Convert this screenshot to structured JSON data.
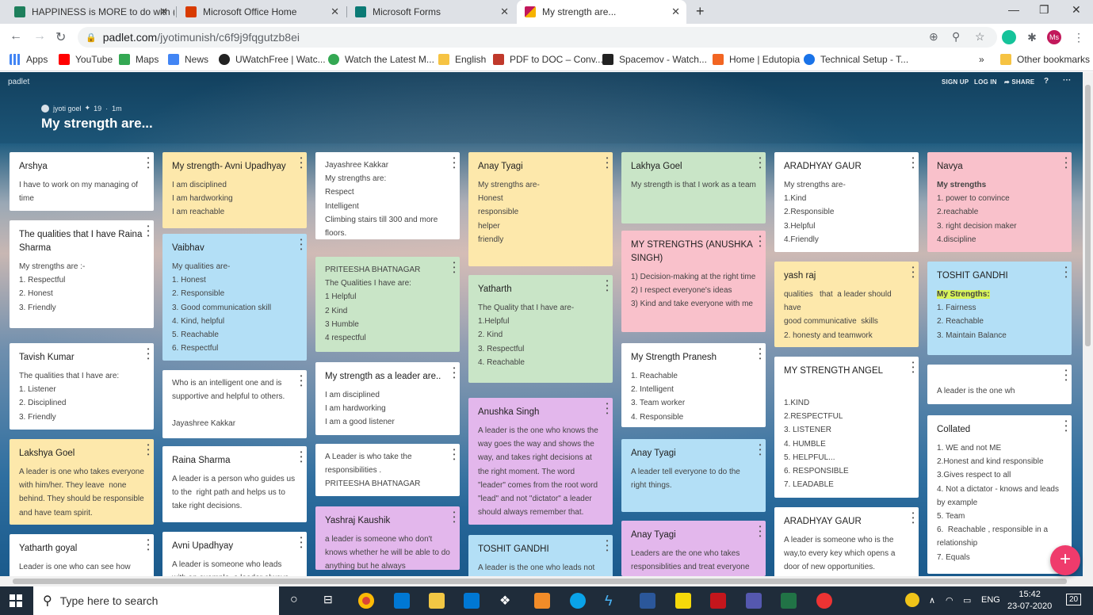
{
  "browser": {
    "tabs": [
      {
        "title": "HAPPINESS is MORE to do with (",
        "color": "#1e7f5c"
      },
      {
        "title": "Microsoft Office Home",
        "color": "#d83b01"
      },
      {
        "title": "Microsoft Forms",
        "color": "#0b7a75"
      },
      {
        "title": "My strength are...",
        "color": "#c2185b"
      }
    ],
    "url_host": "padlet.com",
    "url_path": "/jyotimunish/c6f9j9fqgutzb8ei",
    "profile_initials": "Ms",
    "bookmarks": [
      {
        "label": "Apps",
        "color": "#4285f4"
      },
      {
        "label": "YouTube",
        "color": "#ff0000"
      },
      {
        "label": "Maps",
        "color": "#34a853"
      },
      {
        "label": "News",
        "color": "#4285f4"
      },
      {
        "label": "UWatchFree | Watc...",
        "color": "#222222"
      },
      {
        "label": "Watch the Latest M...",
        "color": "#34a853"
      },
      {
        "label": "English",
        "color": "#f6c343"
      },
      {
        "label": "PDF to DOC – Conv...",
        "color": "#c0392b"
      },
      {
        "label": "Spacemov - Watch...",
        "color": "#222222"
      },
      {
        "label": "Home | Edutopia",
        "color": "#f26522"
      },
      {
        "label": "Technical Setup - T...",
        "color": "#1a73e8"
      }
    ],
    "overflow": "»",
    "other_bookmarks": "Other bookmarks"
  },
  "padlet": {
    "logo": "padlet",
    "nav": {
      "signup": "SIGN UP",
      "login": "LOG IN",
      "share": "SHARE"
    },
    "author": "jyoti goel",
    "likes": "19",
    "age": "1m",
    "title": "My strength are...",
    "add_button": "+",
    "columns": [
      [
        {
          "color": "white",
          "title": "Arshya",
          "lines": [
            "I have to work on my managing of time"
          ]
        },
        {
          "color": "white",
          "title": "The qualities that I have Raina Sharma",
          "lines": [
            "My strengths are :-",
            "1. Respectful",
            "2. Honest",
            "3. Friendly"
          ]
        },
        {
          "color": "white",
          "title": "Tavish Kumar",
          "lines": [
            "The qualities that I have are:",
            "1. Listener",
            "2. Disciplined",
            "3. Friendly"
          ]
        },
        {
          "color": "yellow",
          "title": "Lakshya Goel",
          "lines": [
            "A leader is one who takes everyone with him/her. They leave  none behind. They should be responsible and have team spirit."
          ]
        },
        {
          "color": "white",
          "title": "Yatharth goyal",
          "lines": [
            "Leader is one who can see how"
          ]
        }
      ],
      [
        {
          "color": "yellow",
          "title": "My strength- Avni Upadhyay",
          "lines": [
            "I am disciplined",
            "I am hardworking",
            "I am reachable"
          ]
        },
        {
          "color": "blue",
          "title": "Vaibhav",
          "lines": [
            "My qualities are-",
            "1. Honest",
            "2. Responsible",
            "3. Good communication skill",
            "4. Kind, helpful",
            "5. Reachable",
            "6. Respectful"
          ]
        },
        {
          "color": "white",
          "title": "",
          "lines": [
            "Who is an intelligent one and is supportive and helpful to others.",
            "",
            "Jayashree Kakkar"
          ]
        },
        {
          "color": "white",
          "title": "Raina Sharma",
          "lines": [
            "A leader is a person who guides us to the  right path and helps us to take right decisions."
          ]
        },
        {
          "color": "white",
          "title": "Avni Upadhyay",
          "lines": [
            "A leader is someone who leads with an example, a leader always"
          ]
        }
      ],
      [
        {
          "color": "white",
          "title": "",
          "lines": [
            "Jayashree Kakkar",
            "My strengths are:",
            "Respect",
            "Intelligent",
            "Climbing stairs till 300 and more floors."
          ]
        },
        {
          "color": "green",
          "title": "",
          "lines": [
            "PRITEESHA BHATNAGAR",
            "The Qualities I have are:",
            "1 Helpful",
            "2 Kind",
            "3 Humble",
            "4 respectful"
          ]
        },
        {
          "color": "white",
          "title": "My strength as a leader are..",
          "lines": [
            "I am disciplined",
            "I am hardworking",
            "I am a good listener"
          ]
        },
        {
          "color": "white",
          "title": "",
          "lines": [
            "A Leader is who take the responsibilities .",
            "PRITEESHA BHATNAGAR"
          ]
        },
        {
          "color": "purple",
          "title": "Yashraj Kaushik",
          "lines": [
            "a leader is someone who don't  knows whether he will be able to do anything but he always"
          ]
        }
      ],
      [
        {
          "color": "yellow",
          "title": "Anay Tyagi",
          "lines": [
            "My strengths are-",
            "Honest",
            "responsible",
            "helper",
            "friendly"
          ]
        },
        {
          "color": "green",
          "title": "Yatharth",
          "lines": [
            "The Quality that I have are-",
            "1.Helpful",
            "2. Kind",
            "3. Respectful",
            "4. Reachable"
          ]
        },
        {
          "color": "purple",
          "title": "Anushka Singh",
          "lines": [
            "A leader is the one who knows the way goes the way and shows the way, and takes right decisions at the right moment. The word \"leader\" comes from the root word \"lead\" and not \"dictator\" a leader should always remember that."
          ]
        },
        {
          "color": "blue",
          "title": "TOSHIT GANDHI",
          "lines": [
            "A leader is the one who leads not"
          ]
        }
      ],
      [
        {
          "color": "green",
          "title": "Lakhya Goel",
          "lines": [
            "My strength is that I work as a team"
          ]
        },
        {
          "color": "pink",
          "title": "MY STRENGTHS (ANUSHKA SINGH)",
          "lines": [
            "1) Decision-making at the right time",
            "2) I respect everyone's ideas",
            "3) Kind and take everyone with me"
          ]
        },
        {
          "color": "white",
          "title": "My Strength Pranesh",
          "lines": [
            "1. Reachable",
            "2. Intelligent",
            "3. Team worker",
            "4. Responsible"
          ]
        },
        {
          "color": "blue",
          "title": "Anay Tyagi",
          "lines": [
            "A leader tell everyone to do the right things."
          ]
        },
        {
          "color": "purple",
          "title": "Anay Tyagi",
          "lines": [
            "Leaders are the one who takes responsiblities and treat everyone"
          ]
        }
      ],
      [
        {
          "color": "white",
          "title": "ARADHYAY GAUR",
          "lines": [
            "My strengths are-",
            "1.Kind",
            "2.Responsible",
            "3.Helpful",
            "4.Friendly"
          ]
        },
        {
          "color": "yellow",
          "title": "yash raj",
          "lines": [
            "qualities   that  a leader should have",
            "good communicative  skills",
            "2. honesty and teamwork"
          ]
        },
        {
          "color": "white",
          "title": "MY STRENGTH ANGEL",
          "lines": [
            "",
            "1.KIND",
            "2.RESPECTFUL",
            "3. LISTENER",
            "4. HUMBLE",
            "5. HELPFUL...",
            "6. RESPONSIBLE",
            "7. LEADABLE"
          ]
        },
        {
          "color": "white",
          "title": "ARADHYAY GAUR",
          "lines": [
            "A leader is someone who is the way,to every key which opens a door of new opportunities."
          ]
        }
      ],
      [
        {
          "color": "pink",
          "title": "Navya",
          "lines": [
            "My strengths",
            "1. power to convince",
            "2.reachable",
            "3. right decision maker",
            "4.discipline"
          ]
        },
        {
          "color": "blue",
          "title": "TOSHIT GANDHI",
          "lines": [
            "My Strengths:",
            "1. Fairness",
            "2. Reachable",
            "3. Maintain Balance"
          ]
        },
        {
          "color": "white",
          "title": "",
          "lines": [
            "",
            "A leader is the one wh"
          ]
        },
        {
          "color": "white",
          "title": "Collated",
          "lines": [
            "1. WE and not ME",
            "2.Honest and kind responsible",
            "3.Gives respect to all",
            "4. Not a dictator - knows and leads by example",
            "5. Team",
            "6.  Reachable , responsible in a relationship",
            "7. Equals"
          ]
        }
      ]
    ]
  },
  "taskbar": {
    "search_placeholder": "Type here to search",
    "language": "ENG",
    "time": "15:42",
    "date": "23-07-2020",
    "notifications": "20"
  }
}
